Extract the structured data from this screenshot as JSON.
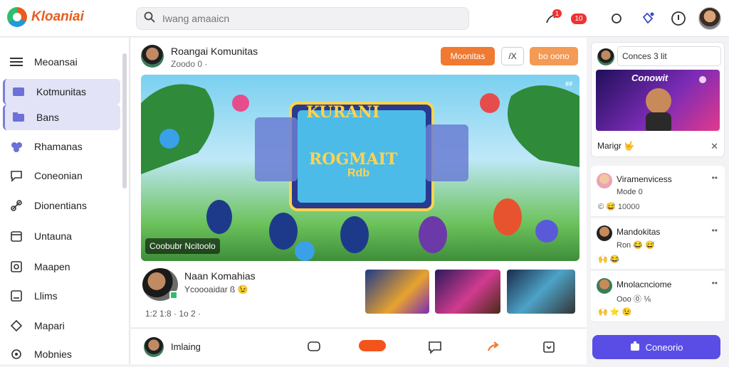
{
  "app": {
    "logo_text": "Kloaniai"
  },
  "search": {
    "placeholder": "Iwang amaaicn"
  },
  "topbar": {
    "notif_badge": "1",
    "live_badge": "10"
  },
  "sidebar": {
    "items": [
      {
        "label": "Meoansai",
        "icon": "menu-icon"
      },
      {
        "label": "Kotmunitas",
        "icon": "community-icon"
      },
      {
        "label": "Bans",
        "icon": "folder-icon"
      },
      {
        "label": "Rhamanas",
        "icon": "users-icon"
      },
      {
        "label": "Coneonian",
        "icon": "chat-icon"
      },
      {
        "label": "Dionentians",
        "icon": "link-icon"
      },
      {
        "label": "Untauna",
        "icon": "calendar-icon"
      },
      {
        "label": "Maapen",
        "icon": "map-icon"
      },
      {
        "label": "Llims",
        "icon": "list-icon"
      },
      {
        "label": "Mapari",
        "icon": "pin-icon"
      },
      {
        "label": "Mobnies",
        "icon": "settings-icon"
      }
    ]
  },
  "post": {
    "title": "Roangai Komunitas",
    "meta": "Zoodo 0 ·",
    "btn_primary": "Moonitas",
    "btn_outline": "/X",
    "btn_secondary": "bo oono",
    "hero_caption": "Coobubr Ncitoolo",
    "hero_tag": "##",
    "hero_title_1": "KURANI",
    "hero_title_2": "ROGMAIT",
    "hero_title_3": "Rdb"
  },
  "post2": {
    "title": "Naan Komahias",
    "subtitle": "Ycoooaidar ß 😉",
    "meta": "1:2 1:8 · 1o 2 ·"
  },
  "actionbar": {
    "label": "Imlaing"
  },
  "right": {
    "comment_input": "Conces  3 lit",
    "promo_title": "Conowit",
    "promo_footer": "Marigr 🤟",
    "feed": [
      {
        "name": "Viramenvicess",
        "sub": "Mode 0",
        "react": "© 😅 10000"
      },
      {
        "name": "Mandokitas",
        "sub": "Ron 😂 😅",
        "react": "🙌 😂"
      },
      {
        "name": "Mnolacnciome",
        "sub": "Ooo ⓪ ⅙",
        "react": "🙌 ⭐ 😉"
      }
    ],
    "create_label": "Coneorio"
  }
}
